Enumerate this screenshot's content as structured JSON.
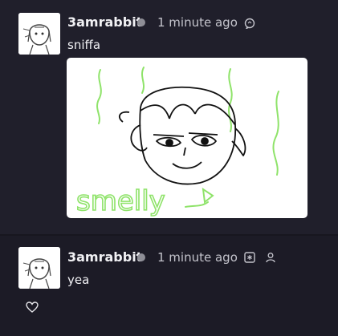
{
  "messages": [
    {
      "author": "3amrabbit",
      "time": "1 minute ago",
      "text": "sniffa",
      "icons": [
        "avatar",
        "status-dot",
        "reply-bubble-icon"
      ],
      "attachment": {
        "type": "drawing",
        "handwritten_text": "smelly"
      }
    },
    {
      "author": "3amrabbit",
      "time": "1 minute ago",
      "text": "yea",
      "icons": [
        "avatar",
        "status-dot",
        "asterisk-box-icon",
        "person-icon",
        "heart-icon"
      ]
    }
  ],
  "colors": {
    "background": "#1e1d2a",
    "card": "#201f2b",
    "status_dot": "#8e8e96",
    "drawing_green": "#8fe36a"
  }
}
